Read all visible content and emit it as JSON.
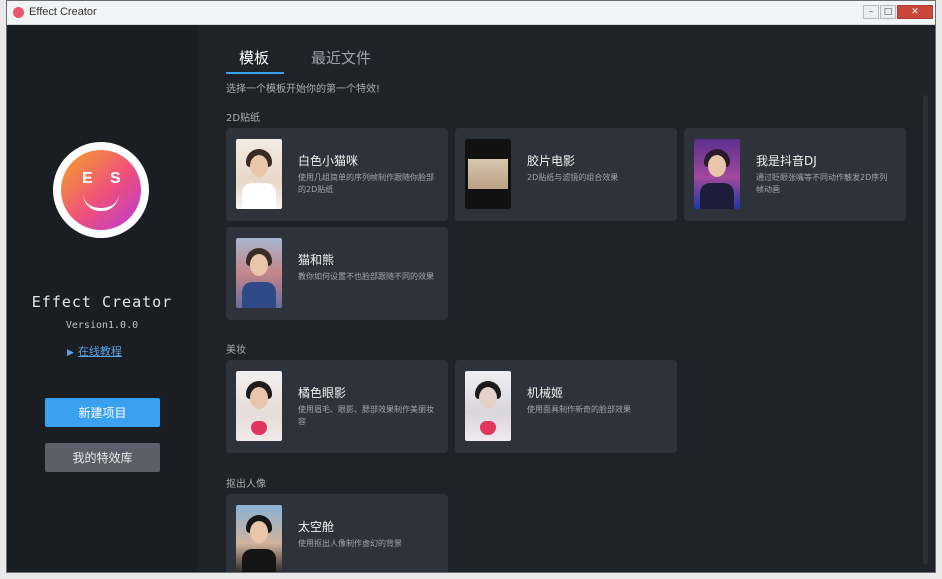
{
  "window": {
    "title": "Effect Creator"
  },
  "sidebar": {
    "app_name": "Effect Creator",
    "version": "Version1.0.0",
    "tutorial_link": "在线教程",
    "new_project_button": "新建项目",
    "my_effects_button": "我的特效库",
    "logo_letters": {
      "left": "E",
      "right": "S"
    }
  },
  "main": {
    "tabs": [
      {
        "label": "模板",
        "active": true
      },
      {
        "label": "最近文件",
        "active": false
      }
    ],
    "hint": "选择一个模板开始你的第一个特效!",
    "sections": [
      {
        "label": "2D贴纸",
        "cards": [
          {
            "title": "白色小猫咪",
            "desc": "使用几组简单的序列帧制作跟随你脸部的2D贴纸"
          },
          {
            "title": "胶片电影",
            "desc": "2D贴纸与滤镜的组合效果"
          },
          {
            "title": "我是抖音DJ",
            "desc": "通过眨眼张嘴等不同动作触发2D序列帧动画"
          },
          {
            "title": "猫和熊",
            "desc": "教你如何设置不也脸部跟随不同的效果"
          }
        ]
      },
      {
        "label": "美妆",
        "cards": [
          {
            "title": "橘色眼影",
            "desc": "使用眉毛、眼影、腮部效果制作美丽妆容"
          },
          {
            "title": "机械姬",
            "desc": "使用面具制作新奇的脸部效果"
          }
        ]
      },
      {
        "label": "抠出人像",
        "cards": [
          {
            "title": "太空舱",
            "desc": "使用抠出人像制作虚幻的背景"
          }
        ]
      }
    ]
  },
  "colors": {
    "accent": "#3aa0f0",
    "background": "#1f2228",
    "sidebar": "#1a1d22",
    "card": "#2e323a"
  }
}
